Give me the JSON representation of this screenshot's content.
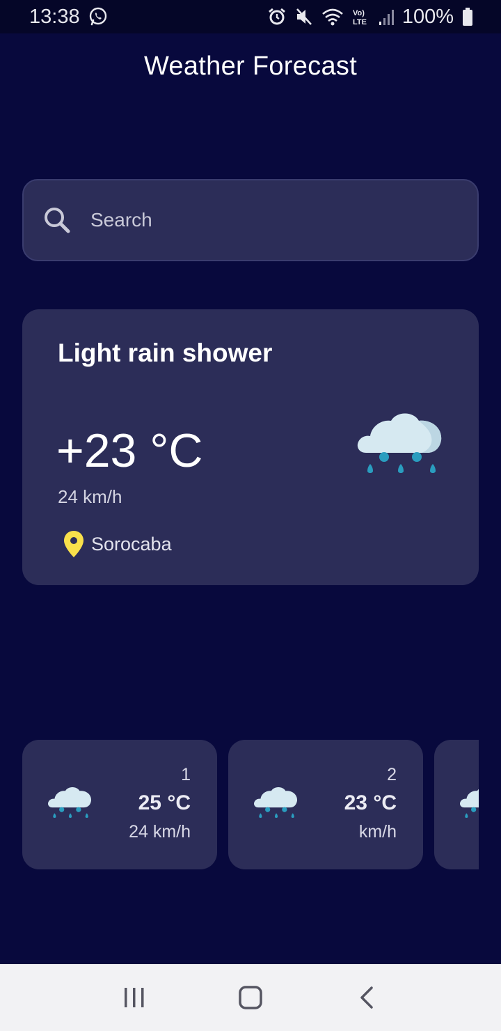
{
  "status_bar": {
    "time": "13:38",
    "battery": "100%",
    "icons": [
      "whatsapp-icon",
      "alarm-icon",
      "mute-icon",
      "wifi-icon",
      "volte-icon",
      "signal-icon",
      "battery-icon"
    ]
  },
  "app": {
    "title": "Weather Forecast"
  },
  "search": {
    "placeholder": "Search",
    "icon": "search-icon"
  },
  "current": {
    "condition": "Light rain shower",
    "temperature": "+23 °C",
    "wind": "24 km/h",
    "location": "Sorocaba",
    "icon": "rain-cloud-icon"
  },
  "forecast": [
    {
      "day": "1",
      "temperature": "25 °C",
      "wind": "24 km/h",
      "icon": "rain-cloud-icon"
    },
    {
      "day": "2",
      "temperature": "23 °C",
      "wind": "km/h",
      "icon": "rain-cloud-icon"
    },
    {
      "day": "",
      "temperature": "",
      "wind": "",
      "icon": "rain-cloud-icon"
    }
  ],
  "nav_bar": {
    "buttons": [
      "recent-apps-icon",
      "home-icon",
      "back-icon"
    ]
  },
  "colors": {
    "background": "#08093d",
    "card": "#2c2d58",
    "pin": "#f9e04b",
    "rain_drop": "#2a9dbf",
    "cloud": "#d6e9f1"
  }
}
